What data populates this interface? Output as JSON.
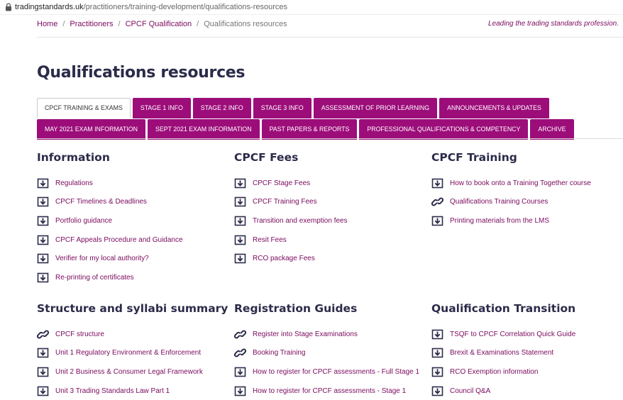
{
  "browser": {
    "url_host": "tradingstandards.uk",
    "url_path": "/practitioners/training-development/qualifications-resources"
  },
  "breadcrumb": {
    "items": [
      "Home",
      "Practitioners",
      "CPCF Qualification"
    ],
    "current": "Qualifications resources",
    "separator": "/"
  },
  "tagline": "Leading the trading standards profession.",
  "page_title": "Qualifications resources",
  "tabs": {
    "row1": [
      "CPCF TRAINING & EXAMS",
      "STAGE 1 INFO",
      "STAGE 2 INFO",
      "STAGE 3 INFO",
      "ASSESSMENT OF PRIOR LEARNING",
      "ANNOUNCEMENTS & UPDATES"
    ],
    "row2": [
      "MAY 2021 EXAM INFORMATION",
      "SEPT 2021 EXAM INFORMATION",
      "PAST PAPERS & REPORTS",
      "PROFESSIONAL QUALIFICATIONS & COMPETENCY",
      "ARCHIVE"
    ],
    "active": "CPCF TRAINING & EXAMS"
  },
  "sections": {
    "information": {
      "title": "Information",
      "items": [
        {
          "label": "Regulations",
          "icon": "download-icon"
        },
        {
          "label": "CPCF Timelines & Deadlines",
          "icon": "download-icon"
        },
        {
          "label": "Portfolio guidance",
          "icon": "download-icon"
        },
        {
          "label": "CPCF Appeals Procedure and Guidance",
          "icon": "download-icon"
        },
        {
          "label": "Verifier for my local authority?",
          "icon": "download-icon"
        },
        {
          "label": "Re-printing of certificates",
          "icon": "download-icon"
        }
      ]
    },
    "fees": {
      "title": "CPCF Fees",
      "items": [
        {
          "label": "CPCF Stage Fees",
          "icon": "download-icon"
        },
        {
          "label": "CPCF Training Fees",
          "icon": "download-icon"
        },
        {
          "label": "Transition and exemption fees",
          "icon": "download-icon"
        },
        {
          "label": "Resit Fees",
          "icon": "download-icon"
        },
        {
          "label": "RCO package Fees",
          "icon": "download-icon"
        }
      ]
    },
    "training": {
      "title": "CPCF Training",
      "items": [
        {
          "label": "How to book onto a Training Together course",
          "icon": "download-icon"
        },
        {
          "label": "Qualifications Training Courses",
          "icon": "link-icon"
        },
        {
          "label": "Printing materials from the LMS",
          "icon": "download-icon"
        }
      ]
    },
    "structure": {
      "title": "Structure and syllabi summary",
      "items": [
        {
          "label": "CPCF structure",
          "icon": "link-icon"
        },
        {
          "label": "Unit 1 Regulatory Environment & Enforcement",
          "icon": "download-icon"
        },
        {
          "label": "Unit 2 Business & Consumer Legal Framework",
          "icon": "download-icon"
        },
        {
          "label": "Unit 3 Trading Standards Law Part 1",
          "icon": "download-icon"
        }
      ]
    },
    "registration": {
      "title": "Registration Guides",
      "items": [
        {
          "label": "Register into Stage Examinations",
          "icon": "link-icon"
        },
        {
          "label": "Booking Training",
          "icon": "link-icon"
        },
        {
          "label": "How to register for CPCF assessments - Full Stage 1",
          "icon": "download-icon"
        },
        {
          "label": "How to register for CPCF assessments - Stage 1",
          "icon": "download-icon"
        }
      ]
    },
    "transition": {
      "title": "Qualification Transition",
      "items": [
        {
          "label": "TSQF to CPCF Correlation Quick Guide",
          "icon": "download-icon"
        },
        {
          "label": "Brexit & Examinations Statement",
          "icon": "download-icon"
        },
        {
          "label": "RCO Exemption information",
          "icon": "download-icon"
        },
        {
          "label": "Council Q&A",
          "icon": "download-icon"
        }
      ]
    }
  },
  "colors": {
    "brand": "#9c0d7a",
    "link": "#7a0a5e",
    "heading": "#2b2b4a"
  }
}
